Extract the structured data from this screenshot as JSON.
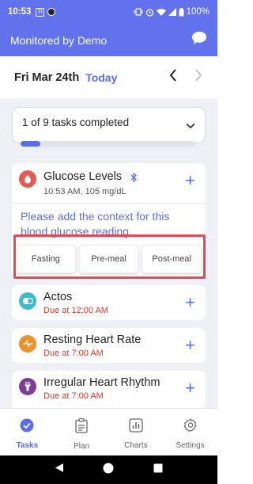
{
  "status_bar": {
    "time": "10:53",
    "calendar_badge": "31",
    "battery": "100%"
  },
  "app_bar": {
    "title": "Monitored by Demo",
    "chat_icon": "chat-bubble-icon"
  },
  "date_bar": {
    "date": "Fri Mar 24th",
    "today_label": "Today"
  },
  "progress": {
    "text": "1 of 9 tasks completed",
    "completed": 1,
    "total": 9
  },
  "glucose_task": {
    "name": "Glucose Levels",
    "subtitle": "10:53 AM, 105 mg/dL",
    "prompt": "Please add the context for this blood glucose reading.",
    "context_options": [
      "Fasting",
      "Pre-meal",
      "Post-meal"
    ],
    "color": "#e65a4f"
  },
  "tasks": [
    {
      "name": "Actos",
      "due": "Due at 12:00 AM",
      "color": "#3bbcc8",
      "icon": "pill-icon"
    },
    {
      "name": "Resting Heart Rate",
      "due": "Due at 7:00 AM",
      "color": "#f0902a",
      "icon": "heartbeat-icon"
    },
    {
      "name": "Irregular Heart Rhythm",
      "due": "Due at 7:00 AM",
      "color": "#7d3f95",
      "icon": "heart-rhythm-icon"
    }
  ],
  "tabs": [
    {
      "label": "Tasks",
      "icon": "check-circle-icon",
      "active": true
    },
    {
      "label": "Plan",
      "icon": "clipboard-icon",
      "active": false
    },
    {
      "label": "Charts",
      "icon": "chart-icon",
      "active": false
    },
    {
      "label": "Settings",
      "icon": "gear-icon",
      "active": false
    }
  ],
  "colors": {
    "primary": "#6272ec",
    "accent": "#5b6ee8",
    "due_red": "#e2392e",
    "highlight": "#e34a56"
  }
}
